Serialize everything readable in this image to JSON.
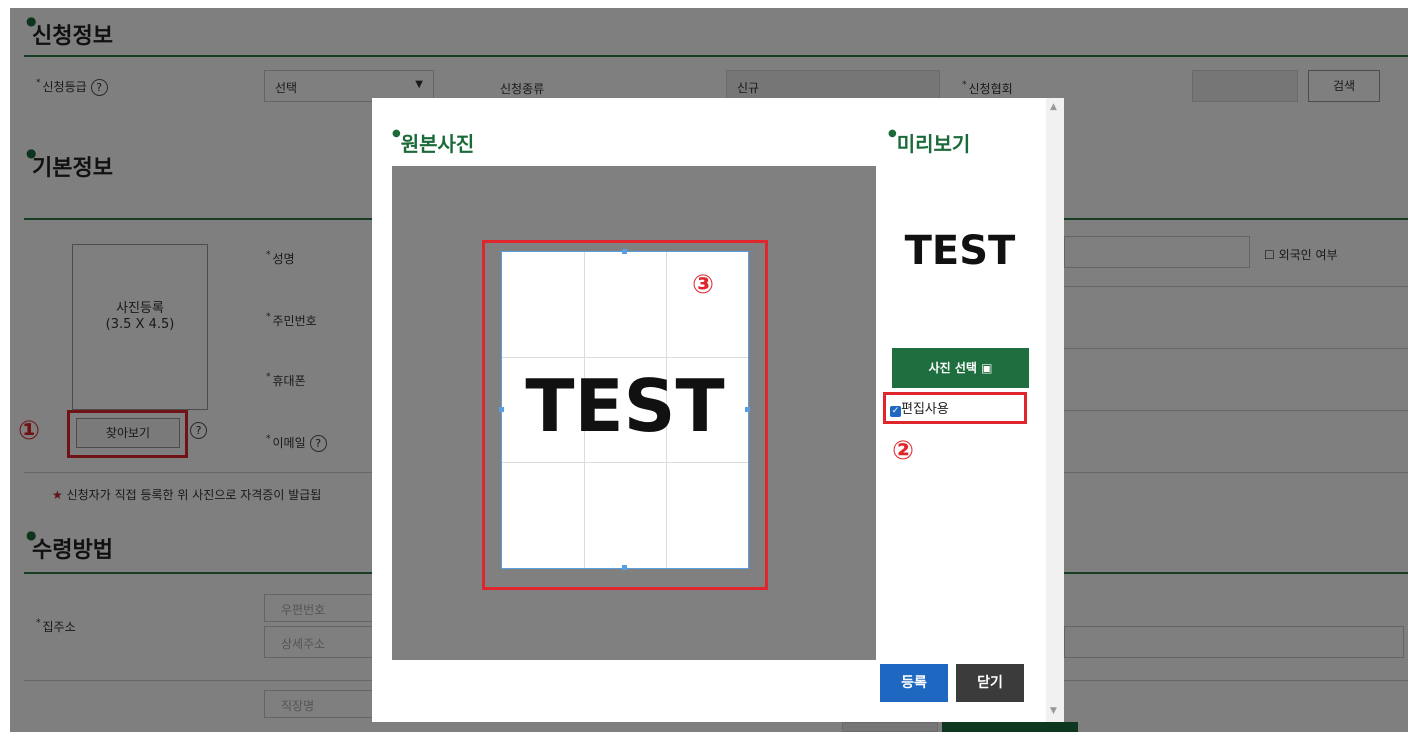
{
  "sections": {
    "apply_info": "신청정보",
    "basic_info": "기본정보",
    "receive_method": "수령방법"
  },
  "apply_row": {
    "grade_label": "신청등급",
    "grade_select": "선택",
    "type_label": "신청종류",
    "type_value": "신규",
    "assoc_label": "신청협회",
    "search_btn": "검색"
  },
  "basic": {
    "photo_placeholder_line1": "사진등록",
    "photo_placeholder_line2": "(3.5 X 4.5)",
    "browse_btn": "찾아보기",
    "name_label": "성명",
    "resident_label": "주민번호",
    "phone_label": "휴대폰",
    "email_label": "이메일",
    "foreigner_label": "외국인 여부",
    "notice": "신청자가 직접 등록한 위 사진으로 자격증이 발급됩"
  },
  "receive": {
    "home_addr_label": "집주소",
    "zip_placeholder": "우편번호",
    "detail_placeholder": "상세주소",
    "work_placeholder": "직장명"
  },
  "modal": {
    "original_title": "원본사진",
    "preview_title": "미리보기",
    "crop_text": "TEST",
    "preview_text": "TEST",
    "select_photo_btn": "사진 선택",
    "edit_use_label": "편집사용",
    "register_btn": "등록",
    "close_btn": "닫기"
  },
  "markers": {
    "m1": "①",
    "m2": "②",
    "m3": "③"
  },
  "colors": {
    "accent_green": "#1e6e3f",
    "marker_red": "#e0262d",
    "register_blue": "#1f68c1"
  }
}
